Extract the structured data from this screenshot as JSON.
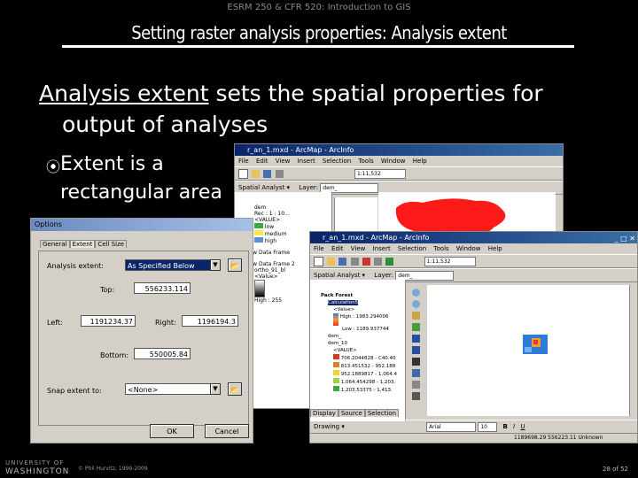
{
  "slide": {
    "course": "ESRM 250 & CFR 520: Introduction to GIS",
    "title": "Setting raster analysis properties:  Analysis extent",
    "body_term": "Analysis extent",
    "body_rest": " sets the spatial properties for",
    "body_line2": "output of analyses",
    "bullet_line1": "Extent is a",
    "bullet_line2": "rectangular area"
  },
  "arcmap_back": {
    "title": "r_an_1.mxd - ArcMap - ArcInfo",
    "menu": [
      "File",
      "Edit",
      "View",
      "Insert",
      "Selection",
      "Tools",
      "Window",
      "Help"
    ],
    "scale": "1:11,532",
    "spatial_analyst": "Spatial Analyst",
    "layer_label": "Layer:",
    "layer_value": "dem_",
    "toc": {
      "layer": "dem",
      "value": "Rec : 1 : 10...",
      "values_header": "<VALUE>",
      "classes": [
        "low",
        "medium",
        "high"
      ],
      "frame1": "New Data Frame",
      "frame2": "New Data Frame 2",
      "ortho": "ortho_91_bl",
      "ortho_value": "<Value>",
      "high": "High : 255"
    }
  },
  "arcmap_front": {
    "title": "r_an_1.mxd - ArcMap - ArcInfo",
    "menu": [
      "File",
      "Edit",
      "View",
      "Insert",
      "Selection",
      "Tools",
      "Window",
      "Help"
    ],
    "scale": "1:11,532",
    "spatial_analyst": "Spatial Analyst",
    "layer_label": "Layer:",
    "layer_value": "dem_",
    "toc": {
      "frame": "Pack Forest",
      "layer1": "Calculation5",
      "value": "<Value>",
      "high": "High : 1983.294006",
      "low": "Low : 1189.937744",
      "layer2": "dem_",
      "layer3": "dem_10",
      "values_header": "<VALUE>",
      "ranges": [
        "706.2044828 - C40.40",
        "813.451532 - 952.188",
        "952.1889817 - 1,064.4",
        "1,064.454298 - 1,203.",
        "1,203.53375 - 1,413."
      ]
    },
    "tabs": [
      "Display",
      "Source",
      "Selection"
    ],
    "drawing": "Drawing",
    "font": "Arial",
    "font_size": "10",
    "status": "1189698.29  556223.11  Unknown"
  },
  "options_dialog": {
    "title": "Options",
    "tabs": [
      "General",
      "Extent",
      "Cell Size"
    ],
    "analysis_extent_label": "Analysis extent:",
    "analysis_extent_value": "As Specified Below",
    "top_label": "Top:",
    "top_value": "556233.114",
    "left_label": "Left:",
    "left_value": "1191234.37",
    "right_label": "Right:",
    "right_value": "1196194.3",
    "bottom_label": "Bottom:",
    "bottom_value": "550005.84",
    "snap_label": "Snap extent to:",
    "snap_value": "<None>",
    "ok": "OK",
    "cancel": "Cancel"
  },
  "footer": {
    "univ_line1": "UNIVERSITY OF",
    "univ_line2": "WASHINGTON",
    "copyright": "© Phil Hurvitz, 1999-2009",
    "page": "28 of 52"
  },
  "colors": {
    "title_bar": "#0a246a",
    "window_bg": "#d4d0c8",
    "dem_red": "#ff1a1a",
    "raster_blue": "#2f7bd6",
    "raster_orange": "#f39c2b"
  }
}
